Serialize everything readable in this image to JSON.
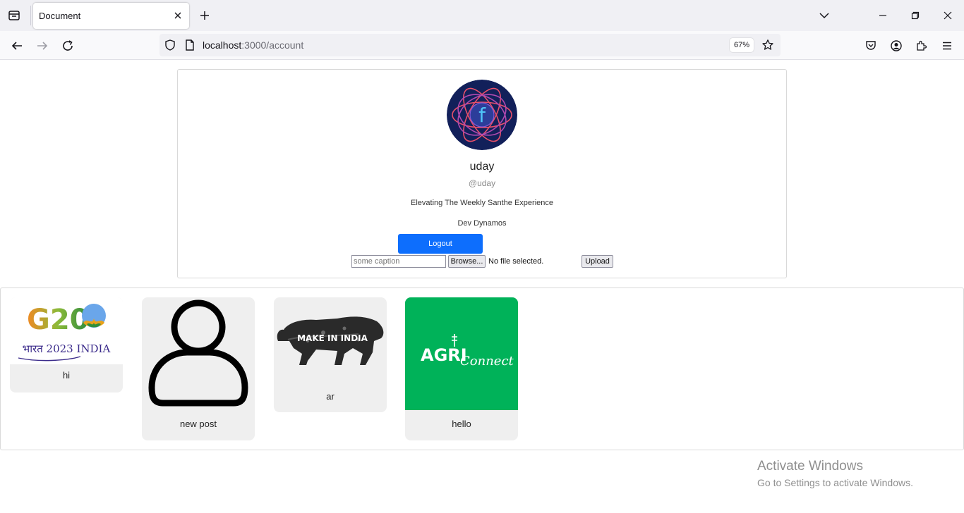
{
  "browser": {
    "tab_title": "Document",
    "url_host": "localhost",
    "url_path": ":3000/account",
    "zoom": "67%"
  },
  "profile": {
    "avatar_letter": "f",
    "username": "uday",
    "handle": "@uday",
    "tagline": "Elevating The Weekly Santhe Experience",
    "team": "Dev Dynamos",
    "logout_label": "Logout",
    "caption_placeholder": "some caption",
    "browse_label": "Browse...",
    "file_status": "No file selected.",
    "upload_label": "Upload"
  },
  "posts": [
    {
      "caption": "hi",
      "image_text": [
        "G20",
        "भारत 2023 INDIA"
      ]
    },
    {
      "caption": "new post"
    },
    {
      "caption": "ar",
      "image_text": [
        "MAKE IN INDIA"
      ]
    },
    {
      "caption": "hello",
      "image_text": [
        "AGRI",
        "Connect"
      ]
    }
  ],
  "watermark": {
    "title": "Activate Windows",
    "subtitle": "Go to Settings to activate Windows."
  },
  "colors": {
    "logout_bg": "#0d6efd",
    "agri_green": "#00b259",
    "avatar_bg": "#12205a"
  }
}
